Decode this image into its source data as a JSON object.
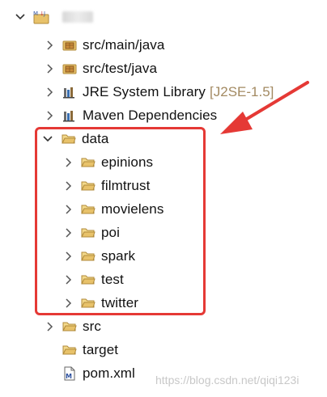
{
  "tree": {
    "items": [
      {
        "label": "src/main/java",
        "icon": "package-folder-icon",
        "expanded": false
      },
      {
        "label": "src/test/java",
        "icon": "package-folder-icon",
        "expanded": false
      },
      {
        "label": "JRE System Library",
        "decoration": "[J2SE-1.5]",
        "icon": "library-icon",
        "expanded": false
      },
      {
        "label": "Maven Dependencies",
        "icon": "library-icon",
        "expanded": false
      },
      {
        "label": "data",
        "icon": "folder-icon",
        "expanded": true,
        "children": [
          {
            "label": "epinions",
            "icon": "folder-icon"
          },
          {
            "label": "filmtrust",
            "icon": "folder-icon"
          },
          {
            "label": "movielens",
            "icon": "folder-icon"
          },
          {
            "label": "poi",
            "icon": "folder-icon"
          },
          {
            "label": "spark",
            "icon": "folder-icon"
          },
          {
            "label": "test",
            "icon": "folder-icon"
          },
          {
            "label": "twitter",
            "icon": "folder-icon"
          }
        ]
      },
      {
        "label": "src",
        "icon": "folder-icon",
        "expanded": false
      },
      {
        "label": "target",
        "icon": "folder-icon"
      },
      {
        "label": "pom.xml",
        "icon": "xml-file-icon"
      }
    ]
  },
  "watermark": "https://blog.csdn.net/qiqi123i",
  "colors": {
    "highlight": "#e53935",
    "folder": "#e8c26a",
    "decoration": "#a38a62"
  }
}
